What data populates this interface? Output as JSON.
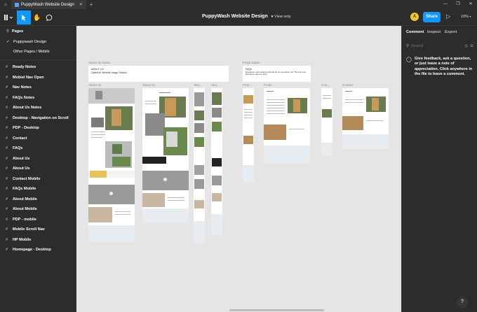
{
  "tabs": [
    {
      "label": "PuppyWash Website Design"
    }
  ],
  "window_controls": {
    "minimize": "—",
    "maximize": "❐",
    "close": "✕"
  },
  "toolbar": {
    "file_title": "PuppyWash Website Design",
    "view_only": "View only",
    "avatar_initial": "A",
    "share_label": "Share",
    "zoom": "10%"
  },
  "left_panel": {
    "pages_header": "Pages",
    "pages": [
      {
        "label": "Puppywash Design",
        "selected": true
      },
      {
        "label": "Other Pages / Mobile",
        "selected": false
      }
    ],
    "layers": [
      "Ready Notes",
      "Mobiel Nav Open",
      "Nav Notes",
      "FAQs Notes",
      "About Us Notes",
      "Desktop - Navigation on Scroll",
      "PDP - Desktop",
      "Contact",
      "FAQs",
      "About Us",
      "About Us",
      "Contact Mobile",
      "FAQs Mobile",
      "About Mobile",
      "About Mobile",
      "PDP - mobile",
      "Mobile Scroll Nav",
      "HP Mobile",
      "Homepage - Desktop"
    ]
  },
  "canvas": {
    "labels": {
      "about_notes": "About Us Notes",
      "faqs_notes": "FAQs Notes",
      "about_us_1": "About Us",
      "about_us_2": "About Us",
      "about_short_1": "Abo...",
      "about_short_2": "Abo...",
      "faq_short": "FAQ...",
      "faqs": "FAQs",
      "con_short": "Con...",
      "contact": "Contact"
    },
    "notes": {
      "about_text": "ABOUT US\nOptimizE Website Image Section",
      "faqs_text": "FAQs\nQuestions and answers should be an accordion list.\nThe first one should be open to start."
    }
  },
  "right_panel": {
    "tabs": [
      "Comment",
      "Inspect",
      "Export"
    ],
    "search_placeholder": "Search",
    "help_text": "Give feedback, ask a question, or just leave a note of appreciation. Click anywhere in the file to leave a comment."
  },
  "colors": {
    "accent": "#0d99ff",
    "canvas_bg": "#e5e5e5",
    "panel_bg": "#2c2c2c",
    "avatar": "#f3c623"
  }
}
